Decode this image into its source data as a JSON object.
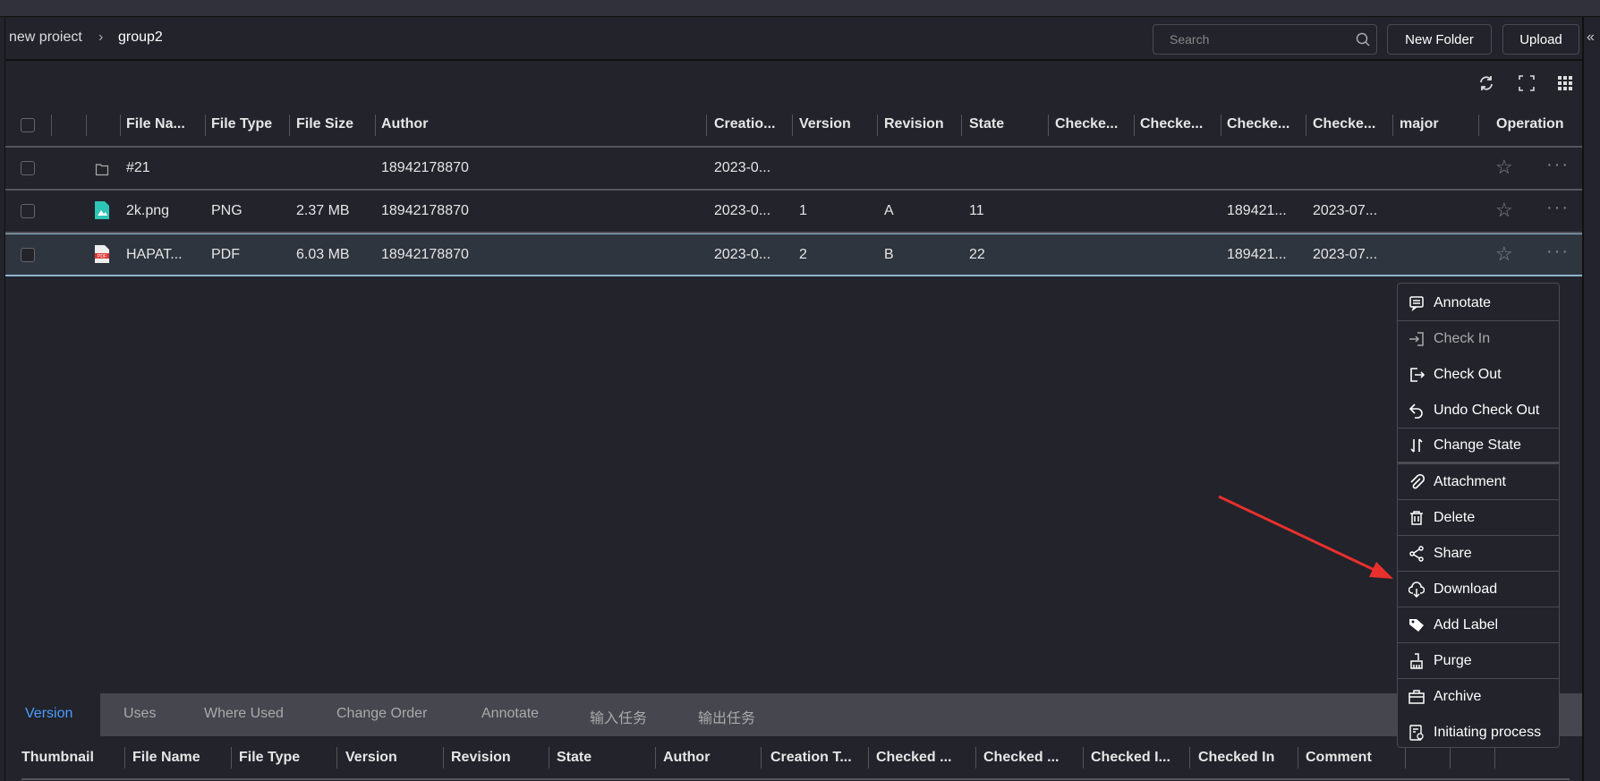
{
  "breadcrumb": {
    "parent": "new proiect",
    "current": "group2"
  },
  "search": {
    "placeholder": "Search"
  },
  "buttons": {
    "new_folder": "New Folder",
    "upload": "Upload"
  },
  "toolbar_icons": [
    "refresh-icon",
    "fullscreen-icon",
    "grid-icon"
  ],
  "table": {
    "headers": [
      "File Na...",
      "File Type",
      "File Size",
      "Author",
      "Creatio...",
      "Version",
      "Revision",
      "State",
      "Checke...",
      "Checke...",
      "Checke...",
      "Checke...",
      "major",
      "Operation"
    ],
    "rows": [
      {
        "icon": "folder",
        "name": "#21",
        "type": "",
        "size": "",
        "author": "18942178870",
        "created": "2023-0...",
        "version": "",
        "revision": "",
        "state": "",
        "c1": "",
        "c2": "",
        "c3": "",
        "c4": "",
        "major": ""
      },
      {
        "icon": "image",
        "name": "2k.png",
        "type": "PNG",
        "size": "2.37 MB",
        "author": "18942178870",
        "created": "2023-0...",
        "version": "1",
        "revision": "A",
        "state": "11",
        "c1": "",
        "c2": "",
        "c3": "189421...",
        "c4": "2023-07...",
        "major": ""
      },
      {
        "icon": "pdf",
        "name": "HAPAT...",
        "type": "PDF",
        "size": "6.03 MB",
        "author": "18942178870",
        "created": "2023-0...",
        "version": "2",
        "revision": "B",
        "state": "22",
        "c1": "",
        "c2": "",
        "c3": "189421...",
        "c4": "2023-07...",
        "major": "",
        "selected": true
      }
    ]
  },
  "menu": [
    {
      "label": "Annotate",
      "icon": "comment-icon"
    },
    {
      "label": "Check In",
      "icon": "check-in-icon",
      "disabled": true
    },
    {
      "label": "Check Out",
      "icon": "check-out-icon"
    },
    {
      "label": "Undo Check Out",
      "icon": "undo-icon"
    },
    {
      "label": "Change State",
      "icon": "swap-icon"
    },
    {
      "label": "Attachment",
      "icon": "paperclip-icon"
    },
    {
      "label": "Delete",
      "icon": "trash-icon"
    },
    {
      "label": "Share",
      "icon": "share-icon"
    },
    {
      "label": "Download",
      "icon": "cloud-download-icon"
    },
    {
      "label": "Add Label",
      "icon": "tag-icon"
    },
    {
      "label": "Purge",
      "icon": "broom-icon"
    },
    {
      "label": "Archive",
      "icon": "archive-icon"
    },
    {
      "label": "Initiating process",
      "icon": "process-icon"
    }
  ],
  "bottom_tabs": {
    "active": "Version",
    "items": [
      "Version",
      "Uses",
      "Where Used",
      "Change Order",
      "Annotate",
      "输入任务",
      "输出任务"
    ]
  },
  "bottom_headers": [
    "Thumbnail",
    "File Name",
    "File Type",
    "Version",
    "Revision",
    "State",
    "Author",
    "Creation T...",
    "Checked ...",
    "Checked ...",
    "Checked I...",
    "Checked In",
    "Comment"
  ],
  "colors": {
    "accent": "#4a9eff",
    "annotation_arrow": "#e8302c",
    "selected_row_border": "#8fb4cc"
  }
}
